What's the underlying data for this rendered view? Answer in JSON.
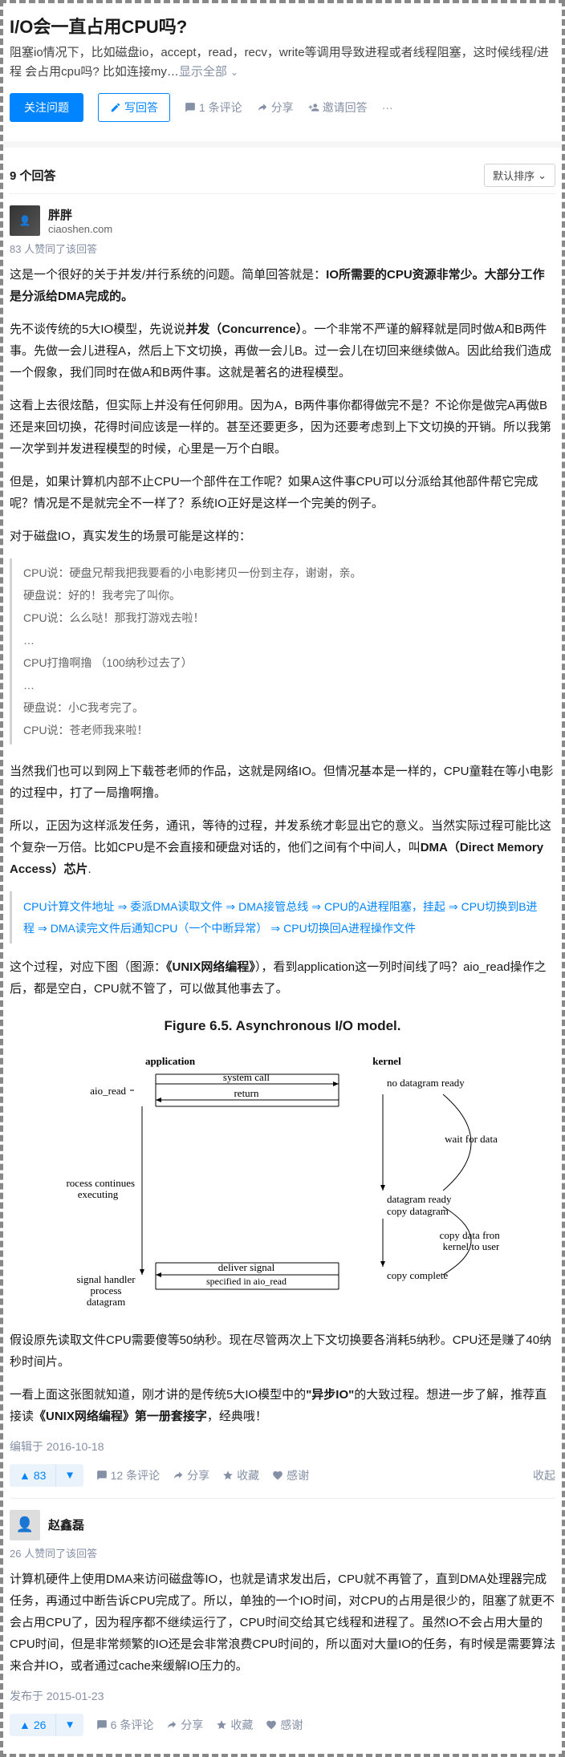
{
  "question": {
    "title": "I/O会一直占用CPU吗?",
    "body": "阻塞io情况下，比如磁盘io，accept，read，recv，write等调用导致进程或者线程阻塞，这时候线程/进程 会占用cpu吗? 比如连接my…",
    "show_all": "显示全部"
  },
  "actions": {
    "follow": "关注问题",
    "write": "写回答",
    "comments": "1 条评论",
    "share": "分享",
    "invite": "邀请回答",
    "more": "···"
  },
  "answers_header": {
    "count": "9 个回答",
    "sort": "默认排序"
  },
  "answer1": {
    "author": "胖胖",
    "bio": "ciaoshen.com",
    "likes": "83 人赞同了该回答",
    "p1a": "这是一个很好的关于并发/并行系统的问题。简单回答就是：",
    "p1b": "IO所需要的CPU资源非常少。大部分工作是分派给DMA完成的。",
    "p2a": "先不谈传统的5大IO模型，先说说",
    "p2b": "并发（Concurrence）",
    "p2c": "。一个非常不严谨的解释就是同时做A和B两件事。先做一会儿进程A，然后上下文切换，再做一会儿B。过一会儿在切回来继续做A。因此给我们造成一个假象，我们同时在做A和B两件事。这就是著名的进程模型。",
    "p3": "这看上去很炫酷，但实际上并没有任何卵用。因为A，B两件事你都得做完不是？不论你是做完A再做B还是来回切换，花得时间应该是一样的。甚至还要更多，因为还要考虑到上下文切换的开销。所以我第一次学到并发进程模型的时候，心里是一万个白眼。",
    "p4": "但是，如果计算机内部不止CPU一个部件在工作呢？如果A这件事CPU可以分派给其他部件帮它完成呢？情况是不是就完全不一样了？系统IO正好是这样一个完美的例子。",
    "p5": "对于磁盘IO，真实发生的场景可能是这样的：",
    "dialogue": [
      "CPU说：硬盘兄帮我把我要看的小电影拷贝一份到主存，谢谢，亲。",
      "硬盘说：好的！我考完了叫你。",
      "CPU说：么么哒！那我打游戏去啦！",
      "…",
      "CPU打撸啊撸 （100纳秒过去了）",
      "…",
      "硬盘说：小C我考完了。",
      "CPU说：苍老师我来啦！"
    ],
    "p6": "当然我们也可以到网上下载苍老师的作品，这就是网络IO。但情况基本是一样的，CPU童鞋在等小电影的过程中，打了一局撸啊撸。",
    "p7a": "所以，正因为这样派发任务，通讯，等待的过程，并发系统才彰显出它的意义。当然实际过程可能比这个复杂一万倍。比如CPU是不会直接和硬盘对话的，他们之间有个中间人，叫",
    "p7b": "DMA（Direct Memory Access）芯片",
    "flow": [
      "CPU计算文件地址",
      "委派DMA读取文件",
      "DMA接管总线",
      "CPU的A进程阻塞，挂起",
      "CPU切换到B进程",
      "DMA读完文件后通知CPU（一个中断异常）",
      "CPU切换回A进程操作文件"
    ],
    "p8a": "这个过程，对应下图（图源：",
    "p8b": "《UNIX网络编程》",
    "p8c": "），看到application这一列时间线了吗？aio_read操作之后，都是空白，CPU就不管了，可以做其他事去了。",
    "diagram": {
      "title": "Figure 6.5. Asynchronous I/O model.",
      "labels": {
        "application": "application",
        "kernel": "kernel",
        "aio_read": "aio_read",
        "system_call": "system call",
        "return": "return",
        "no_datagram": "no datagram ready",
        "wait": "wait for data",
        "process_cont": "process continues\nexecuting",
        "datagram_ready": "datagram ready",
        "copy_datagram": "copy datagram",
        "copy_from": "copy data from\nkernel to user",
        "signal_handler": "signal handler\nprocess\ndatagram",
        "deliver_signal": "deliver signal",
        "specified": "specified in aio_read",
        "copy_complete": "copy complete"
      }
    },
    "p9": "假设原先读取文件CPU需要傻等50纳秒。现在尽管两次上下文切换要各消耗5纳秒。CPU还是赚了40纳秒时间片。",
    "p10a": "一看上面这张图就知道，刚才讲的是传统5大IO模型中的",
    "p10b": "\"异步IO\"",
    "p10c": "的大致过程。想进一步了解，推荐直接读",
    "p10d": "《UNIX网络编程》第一册套接字",
    "p10e": "，经典哦！",
    "edited": "编辑于 2016-10-18",
    "votes": "83",
    "comments": "12 条评论",
    "share": "分享",
    "fav": "收藏",
    "thanks": "感谢",
    "collapse": "收起"
  },
  "answer2": {
    "author": "赵鑫磊",
    "likes": "26 人赞同了该回答",
    "body": "计算机硬件上使用DMA来访问磁盘等IO，也就是请求发出后，CPU就不再管了，直到DMA处理器完成任务，再通过中断告诉CPU完成了。所以，单独的一个IO时间，对CPU的占用是很少的，阻塞了就更不会占用CPU了，因为程序都不继续运行了，CPU时间交给其它线程和进程了。虽然IO不会占用大量的CPU时间，但是非常频繁的IO还是会非常浪费CPU时间的，所以面对大量IO的任务，有时候是需要算法来合并IO，或者通过cache来缓解IO压力的。",
    "published": "发布于 2015-01-23",
    "votes": "26",
    "comments": "6 条评论",
    "share": "分享",
    "fav": "收藏",
    "thanks": "感谢"
  }
}
